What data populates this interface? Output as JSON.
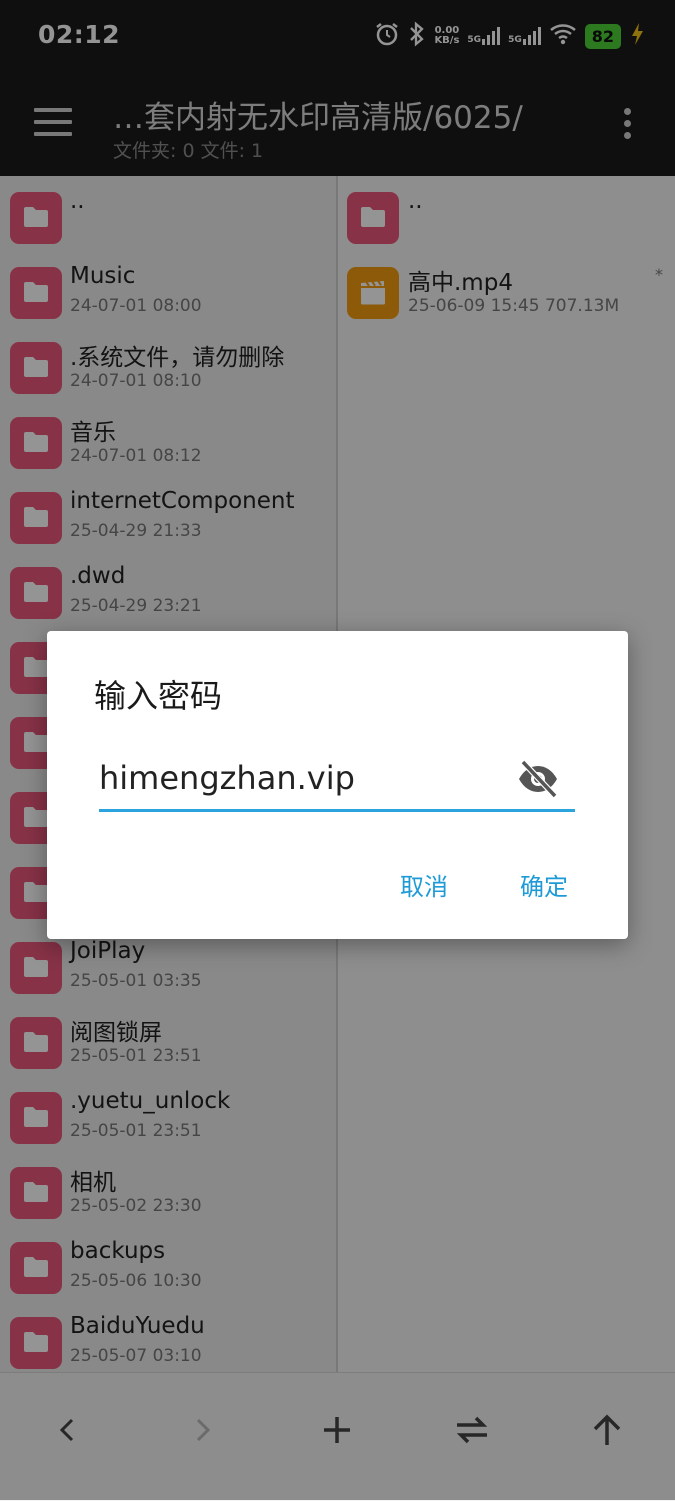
{
  "status_bar": {
    "time": "02:12",
    "net_speed_value": "0.00",
    "net_speed_unit": "KB/s",
    "sim1": "5G",
    "sim2": "5G",
    "battery": "82"
  },
  "app_bar": {
    "title": "…套内射无水印高清版/6025/",
    "subtitle": "文件夹: 0  文件: 1",
    "menu_icon": "hamburger-menu-icon",
    "more_icon": "more-vertical-icon"
  },
  "left_pane": {
    "items": [
      {
        "name": "..",
        "meta": ""
      },
      {
        "name": "Music",
        "meta": "24-07-01 08:00"
      },
      {
        "name": ".系统文件，请勿删除",
        "meta": "24-07-01 08:10"
      },
      {
        "name": "音乐",
        "meta": "24-07-01 08:12"
      },
      {
        "name": "internetComponent",
        "meta": "25-04-29 21:33"
      },
      {
        "name": ".dwd",
        "meta": "25-04-29 23:21"
      },
      {
        "name": "",
        "meta": ""
      },
      {
        "name": "",
        "meta": ""
      },
      {
        "name": "",
        "meta": ""
      },
      {
        "name": "",
        "meta": ""
      },
      {
        "name": "JoiPlay",
        "meta": "25-05-01 03:35"
      },
      {
        "name": "阅图锁屏",
        "meta": "25-05-01 23:51"
      },
      {
        "name": ".yuetu_unlock",
        "meta": "25-05-01 23:51"
      },
      {
        "name": "相机",
        "meta": "25-05-02 23:30"
      },
      {
        "name": "backups",
        "meta": "25-05-06 10:30"
      },
      {
        "name": "BaiduYuedu",
        "meta": "25-05-07 03:10"
      }
    ]
  },
  "right_pane": {
    "items": [
      {
        "name": "..",
        "meta": "",
        "flag": ""
      },
      {
        "name": "高中.mp4",
        "meta": "25-06-09 15:45  707.13M",
        "flag": "*"
      }
    ]
  },
  "bottom_bar": {
    "icons": [
      "back-arrow-icon",
      "forward-arrow-icon",
      "add-icon",
      "swap-icon",
      "up-arrow-icon"
    ]
  },
  "dialog": {
    "title": "输入密码",
    "password_value": "himengzhan.vip",
    "visibility_icon": "eye-off-icon",
    "cancel_label": "取消",
    "ok_label": "确定"
  },
  "colors": {
    "folder": "#e8577a",
    "video": "#f39c12",
    "accent": "#1e9bd7",
    "bar_bg": "#1b1b1b"
  }
}
